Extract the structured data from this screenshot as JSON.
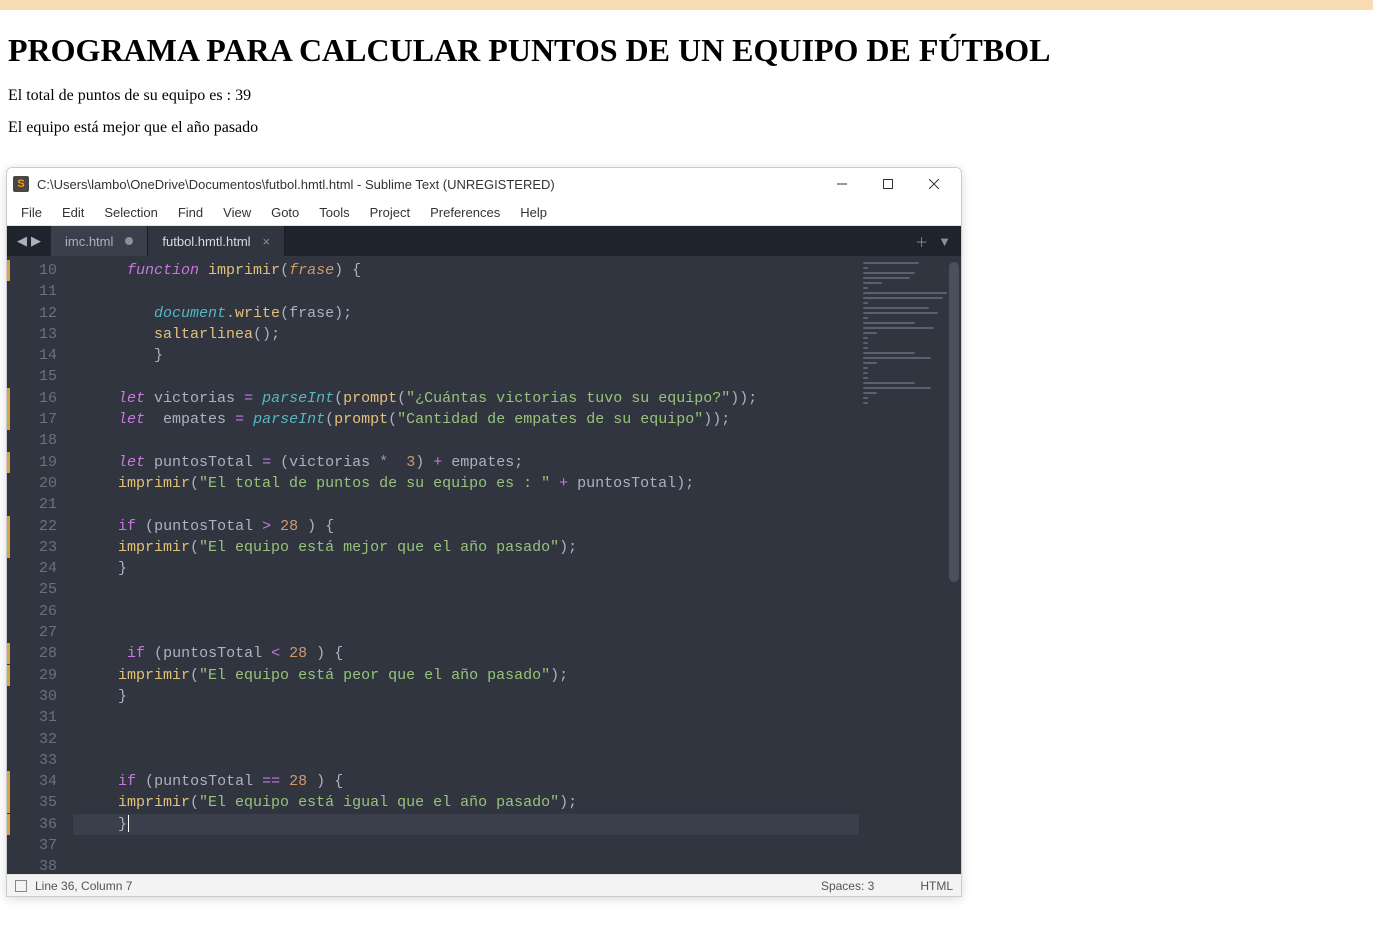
{
  "browser_page": {
    "heading": "PROGRAMA PARA CALCULAR PUNTOS DE UN EQUIPO DE FÚTBOL",
    "line1": "El total de puntos de su equipo es : 39",
    "line2": "El equipo está mejor que el año pasado"
  },
  "sublime": {
    "titlebar": "C:\\Users\\lambo\\OneDrive\\Documentos\\futbol.hmtl.html - Sublime Text (UNREGISTERED)",
    "menu": [
      "File",
      "Edit",
      "Selection",
      "Find",
      "View",
      "Goto",
      "Tools",
      "Project",
      "Preferences",
      "Help"
    ],
    "tabs": [
      {
        "name": "imc.html",
        "active": false,
        "dirty": true
      },
      {
        "name": "futbol.hmtl.html",
        "active": true,
        "dirty": false
      }
    ],
    "statusbar": {
      "position": "Line 36, Column 7",
      "spaces": "Spaces: 3",
      "syntax": "HTML"
    },
    "line_numbers": [
      10,
      11,
      12,
      13,
      14,
      15,
      16,
      17,
      18,
      19,
      20,
      21,
      22,
      23,
      24,
      25,
      26,
      27,
      28,
      29,
      30,
      31,
      32,
      33,
      34,
      35,
      36,
      37,
      38
    ],
    "modified_lines": [
      10,
      16,
      17,
      19,
      22,
      23,
      28,
      29,
      34,
      35,
      36
    ],
    "current_line": 36,
    "code_tokens": [
      [
        [
          "      "
        ],
        [
          "kw-storage",
          "function"
        ],
        [
          " "
        ],
        [
          "fn-name",
          "imprimir"
        ],
        [
          "punct",
          "("
        ],
        [
          "param",
          "frase"
        ],
        [
          "punct",
          ")"
        ],
        [
          " "
        ],
        [
          "punct",
          "{"
        ]
      ],
      [
        [
          ""
        ]
      ],
      [
        [
          "         "
        ],
        [
          "builtin",
          "document"
        ],
        [
          "punct",
          "."
        ],
        [
          "fn-name",
          "write"
        ],
        [
          "punct",
          "("
        ],
        [
          "prop",
          "frase"
        ],
        [
          "punct",
          ")"
        ],
        [
          "punct",
          ";"
        ]
      ],
      [
        [
          "         "
        ],
        [
          "fn-name",
          "saltarlinea"
        ],
        [
          "punct",
          "()"
        ],
        [
          "punct",
          ";"
        ]
      ],
      [
        [
          "         "
        ],
        [
          "punct",
          "}"
        ]
      ],
      [
        [
          ""
        ]
      ],
      [
        [
          "     "
        ],
        [
          "kw-storage",
          "let"
        ],
        [
          " "
        ],
        [
          "prop",
          "victorias"
        ],
        [
          " "
        ],
        [
          "op",
          "="
        ],
        [
          " "
        ],
        [
          "builtin",
          "parseInt"
        ],
        [
          "punct",
          "("
        ],
        [
          "fn-name",
          "prompt"
        ],
        [
          "punct",
          "("
        ],
        [
          "string",
          "\"¿Cuántas victorias tuvo su equipo?\""
        ],
        [
          "punct",
          "))"
        ],
        [
          "punct",
          ";"
        ]
      ],
      [
        [
          "     "
        ],
        [
          "kw-storage",
          "let"
        ],
        [
          "  "
        ],
        [
          "prop",
          "empates"
        ],
        [
          " "
        ],
        [
          "op",
          "="
        ],
        [
          " "
        ],
        [
          "builtin",
          "parseInt"
        ],
        [
          "punct",
          "("
        ],
        [
          "fn-name",
          "prompt"
        ],
        [
          "punct",
          "("
        ],
        [
          "string",
          "\"Cantidad de empates de su equipo\""
        ],
        [
          "punct",
          "))"
        ],
        [
          "punct",
          ";"
        ]
      ],
      [
        [
          ""
        ]
      ],
      [
        [
          "     "
        ],
        [
          "kw-storage",
          "let"
        ],
        [
          " "
        ],
        [
          "prop",
          "puntosTotal"
        ],
        [
          " "
        ],
        [
          "op",
          "="
        ],
        [
          " "
        ],
        [
          "punct",
          "("
        ],
        [
          "prop",
          "victorias"
        ],
        [
          " "
        ],
        [
          "op",
          "*"
        ],
        [
          "  "
        ],
        [
          "num",
          "3"
        ],
        [
          "punct",
          ")"
        ],
        [
          " "
        ],
        [
          "op",
          "+"
        ],
        [
          " "
        ],
        [
          "prop",
          "empates"
        ],
        [
          "punct",
          ";"
        ]
      ],
      [
        [
          "     "
        ],
        [
          "fn-name",
          "imprimir"
        ],
        [
          "punct",
          "("
        ],
        [
          "string",
          "\"El total de puntos de su equipo es : \""
        ],
        [
          " "
        ],
        [
          "op",
          "+"
        ],
        [
          " "
        ],
        [
          "prop",
          "puntosTotal"
        ],
        [
          "punct",
          ")"
        ],
        [
          "punct",
          ";"
        ]
      ],
      [
        [
          ""
        ]
      ],
      [
        [
          "     "
        ],
        [
          "op",
          "if"
        ],
        [
          " "
        ],
        [
          "punct",
          "("
        ],
        [
          "prop",
          "puntosTotal"
        ],
        [
          " "
        ],
        [
          "op",
          ">"
        ],
        [
          " "
        ],
        [
          "num",
          "28"
        ],
        [
          " "
        ],
        [
          "punct",
          ")"
        ],
        [
          " "
        ],
        [
          "punct",
          "{"
        ]
      ],
      [
        [
          "     "
        ],
        [
          "fn-name",
          "imprimir"
        ],
        [
          "punct",
          "("
        ],
        [
          "string",
          "\"El equipo está mejor que el año pasado\""
        ],
        [
          "punct",
          ")"
        ],
        [
          "punct",
          ";"
        ]
      ],
      [
        [
          "     "
        ],
        [
          "punct",
          "}"
        ]
      ],
      [
        [
          ""
        ]
      ],
      [
        [
          ""
        ]
      ],
      [
        [
          ""
        ]
      ],
      [
        [
          "      "
        ],
        [
          "op",
          "if"
        ],
        [
          " "
        ],
        [
          "punct",
          "("
        ],
        [
          "prop",
          "puntosTotal"
        ],
        [
          " "
        ],
        [
          "op",
          "<"
        ],
        [
          " "
        ],
        [
          "num",
          "28"
        ],
        [
          " "
        ],
        [
          "punct",
          ")"
        ],
        [
          " "
        ],
        [
          "punct",
          "{"
        ]
      ],
      [
        [
          "     "
        ],
        [
          "fn-name",
          "imprimir"
        ],
        [
          "punct",
          "("
        ],
        [
          "string",
          "\"El equipo está peor que el año pasado\""
        ],
        [
          "punct",
          ")"
        ],
        [
          "punct",
          ";"
        ]
      ],
      [
        [
          "     "
        ],
        [
          "punct",
          "}"
        ]
      ],
      [
        [
          ""
        ]
      ],
      [
        [
          ""
        ]
      ],
      [
        [
          ""
        ]
      ],
      [
        [
          "     "
        ],
        [
          "op",
          "if"
        ],
        [
          " "
        ],
        [
          "punct",
          "("
        ],
        [
          "prop",
          "puntosTotal"
        ],
        [
          " "
        ],
        [
          "op",
          "=="
        ],
        [
          " "
        ],
        [
          "num",
          "28"
        ],
        [
          " "
        ],
        [
          "punct",
          ")"
        ],
        [
          " "
        ],
        [
          "punct",
          "{"
        ]
      ],
      [
        [
          "     "
        ],
        [
          "fn-name",
          "imprimir"
        ],
        [
          "punct",
          "("
        ],
        [
          "string",
          "\"El equipo está igual que el año pasado\""
        ],
        [
          "punct",
          ")"
        ],
        [
          "punct",
          ";"
        ]
      ],
      [
        [
          "     "
        ],
        [
          "punct",
          "}"
        ]
      ],
      [
        [
          ""
        ]
      ],
      [
        [
          ""
        ]
      ]
    ]
  }
}
